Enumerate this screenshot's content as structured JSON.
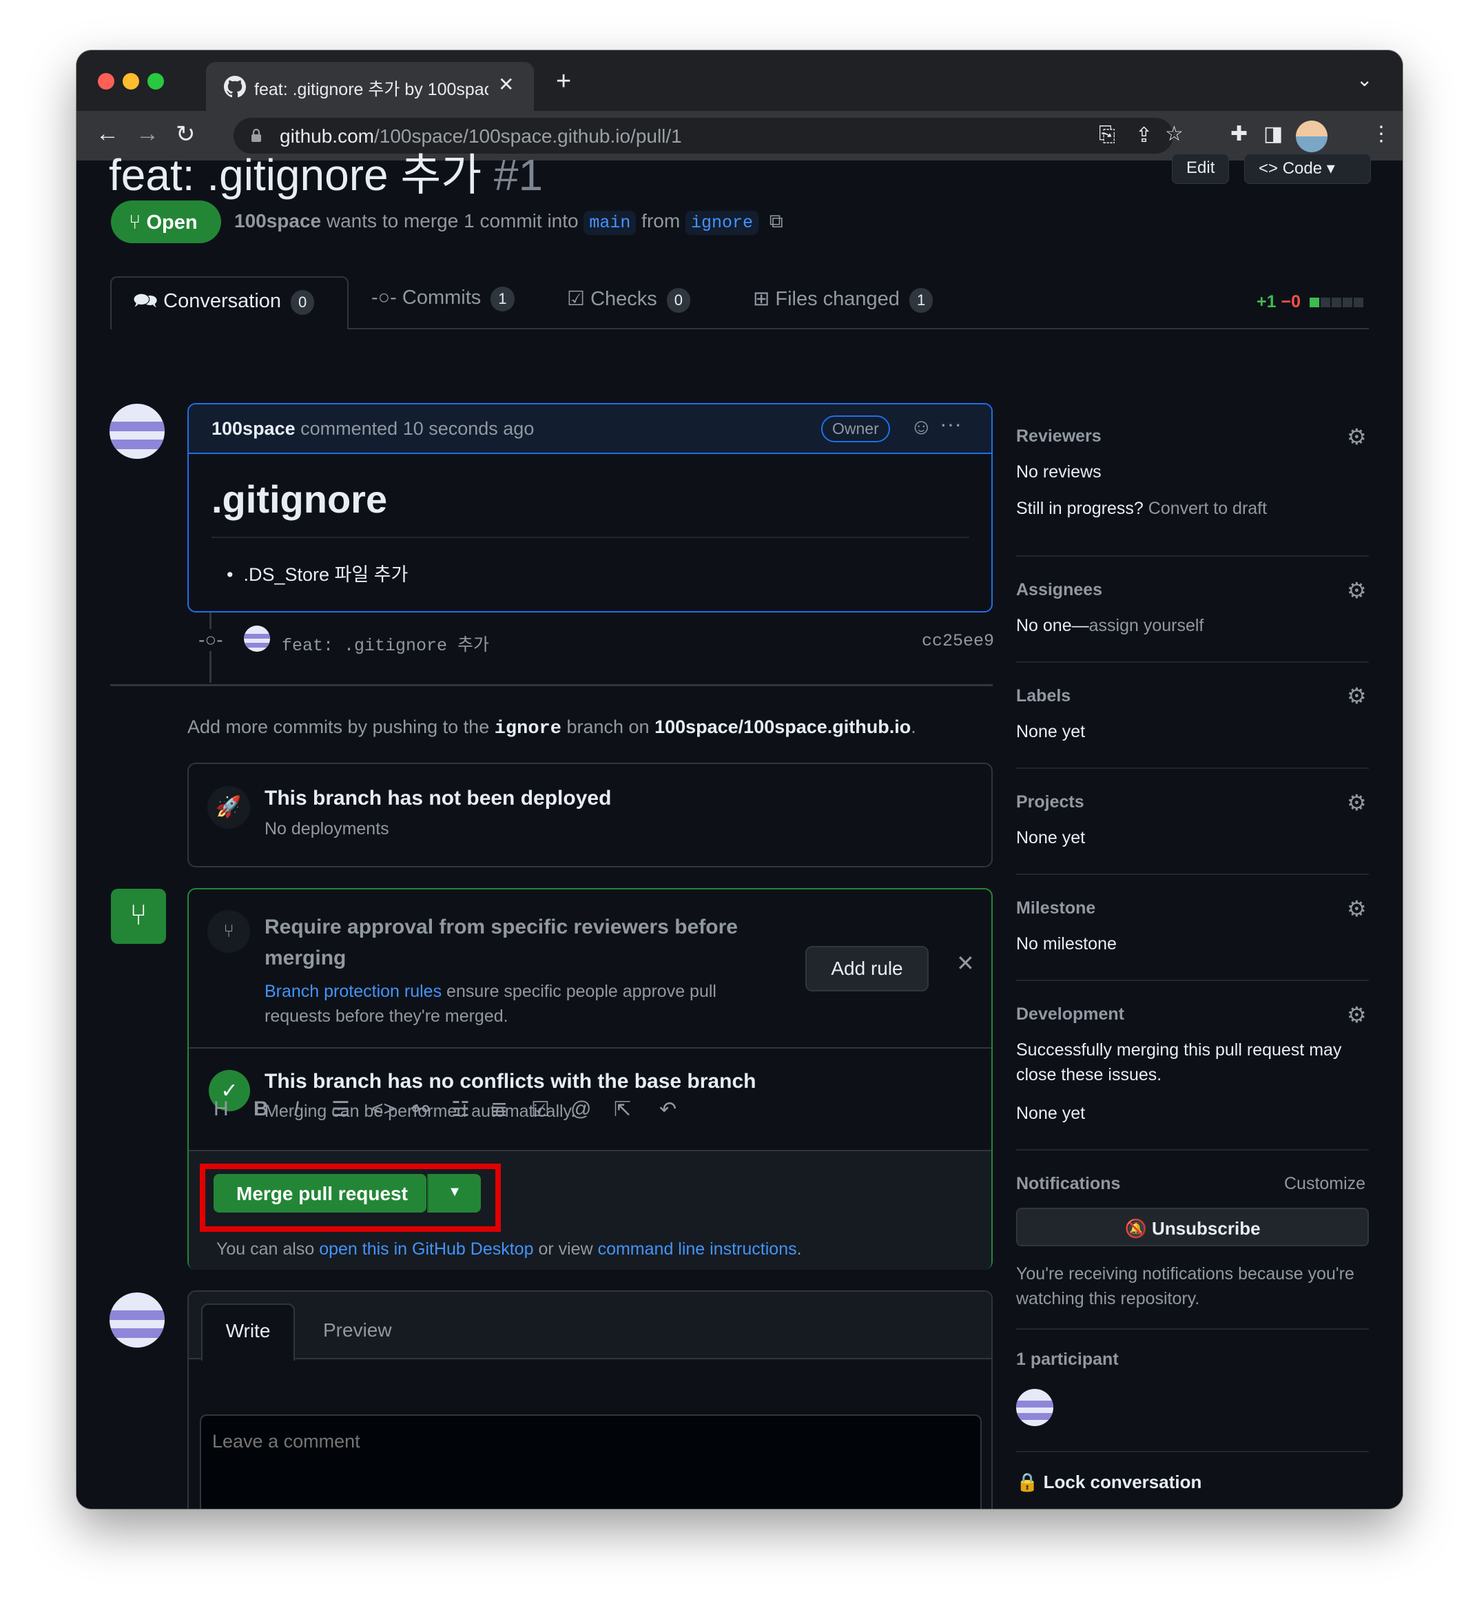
{
  "browser": {
    "tab_title": "feat: .gitignore 추가 by 100spac",
    "url_host": "github.com",
    "url_path": "/100space/100space.github.io/pull/1"
  },
  "header": {
    "title": "feat: .gitignore 추가",
    "number": "#1",
    "edit_label": "Edit",
    "code_label": "Code",
    "state_label": "Open",
    "meta_user": "100space",
    "meta_text1": "wants to merge 1 commit into",
    "base_branch": "main",
    "meta_text2": "from",
    "head_branch": "ignore"
  },
  "tabs": [
    {
      "label": "Conversation",
      "count": "0"
    },
    {
      "label": "Commits",
      "count": "1"
    },
    {
      "label": "Checks",
      "count": "0"
    },
    {
      "label": "Files changed",
      "count": "1"
    }
  ],
  "diffstat": {
    "added": "+1",
    "removed": "−0"
  },
  "comment": {
    "author": "100space",
    "time_text": "commented 10 seconds ago",
    "badge": "Owner",
    "heading": ".gitignore",
    "bullet": ".DS_Store 파일 추가"
  },
  "commit": {
    "message": "feat: .gitignore 추가",
    "sha": "cc25ee9"
  },
  "push_hint": {
    "text1": "Add more commits by pushing to the",
    "branch": "ignore",
    "text2": "branch on",
    "repo": "100space/100space.github.io",
    "text3": "."
  },
  "deploy": {
    "title": "This branch has not been deployed",
    "subtitle": "No deployments"
  },
  "merge_box": {
    "rule_title": "Require approval from specific reviewers before merging",
    "rule_link": "Branch protection rules",
    "rule_desc1": "ensure specific people approve pull",
    "rule_desc2": "requests before they're merged.",
    "add_rule_label": "Add rule",
    "check_title": "This branch has no conflicts with the base branch",
    "check_subtitle": "Merging can be performed automatically.",
    "merge_button_label": "Merge pull request",
    "also_text": "You can also",
    "desktop_link": "open this in GitHub Desktop",
    "or_view": "or view",
    "cli_link": "command line instructions",
    "period": "."
  },
  "editor": {
    "write_tab": "Write",
    "preview_tab": "Preview",
    "placeholder": "Leave a comment"
  },
  "sidebar": {
    "reviewers_h": "Reviewers",
    "reviewers_v": "No reviews",
    "progress_q": "Still in progress?",
    "progress_link": "Convert to draft",
    "assignees_h": "Assignees",
    "assignees_v1": "No one—",
    "assignees_v2": "assign yourself",
    "labels_h": "Labels",
    "labels_v": "None yet",
    "projects_h": "Projects",
    "projects_v": "None yet",
    "milestone_h": "Milestone",
    "milestone_v": "No milestone",
    "development_h": "Development",
    "development_v1": "Successfully merging this pull request may",
    "development_v2": "close these issues.",
    "development_v3": "None yet",
    "notifications_h": "Notifications",
    "customize": "Customize",
    "unsubscribe": "Unsubscribe",
    "notif_v1": "You're receiving notifications because you're",
    "notif_v2": "watching this repository.",
    "participants_h": "1 participant",
    "lock": "Lock conversation"
  },
  "colors": {
    "accent_green": "#238636",
    "link_blue": "#4493f8",
    "highlight_red": "#e00000"
  }
}
